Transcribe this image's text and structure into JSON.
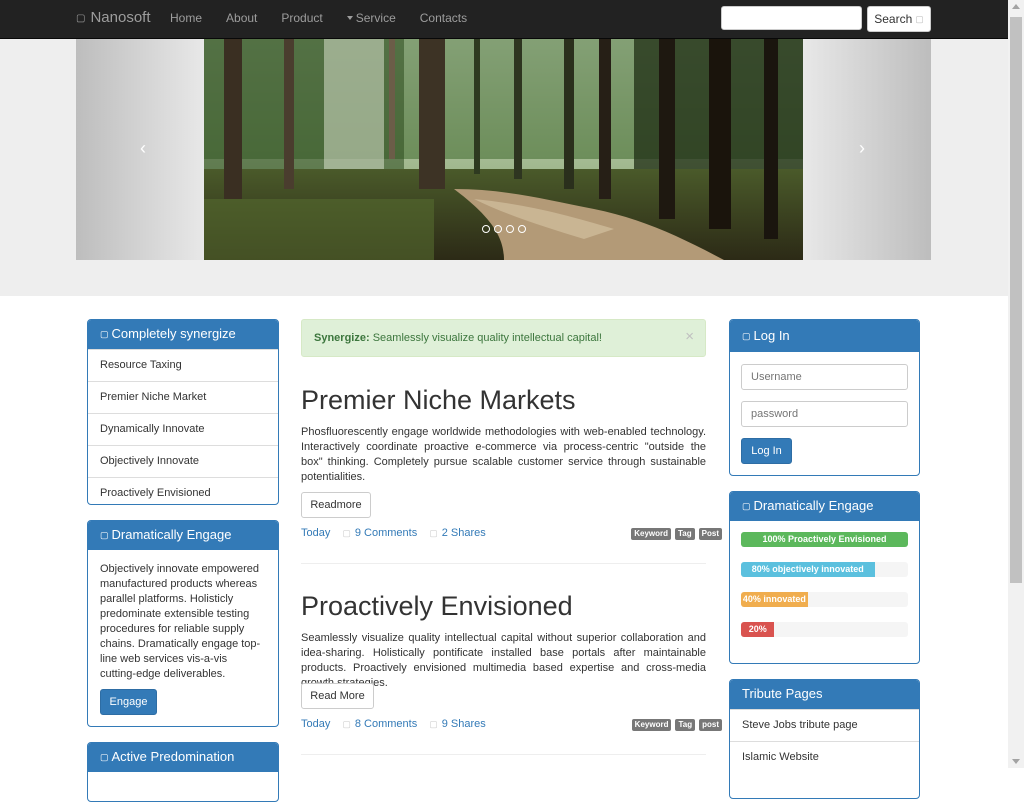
{
  "navbar": {
    "brand": "Nanosoft",
    "links": [
      "Home",
      "About",
      "Product",
      "Service",
      "Contacts"
    ],
    "search_placeholder": "",
    "search_button": "Search"
  },
  "carousel": {
    "prev": "‹",
    "next": "›",
    "indicator_count": 4,
    "active_index": 0
  },
  "left_sidebar": {
    "panel1": {
      "title": "Completely synergize",
      "items": [
        "Resource Taxing",
        "Premier Niche Market",
        "Dynamically Innovate",
        "Objectively Innovate",
        "Proactively Envisioned"
      ]
    },
    "panel2": {
      "title": "Dramatically Engage",
      "body": "Objectively innovate empowered manufactured products whereas parallel platforms. Holisticly predominate extensible testing procedures for reliable supply chains. Dramatically engage top-line web services vis-a-vis cutting-edge deliverables.",
      "button": "Engage"
    },
    "panel3": {
      "title": "Active Predomination"
    }
  },
  "alert": {
    "strong": "Synergize:",
    "text": "Seamlessly visualize quality intellectual capital!",
    "close": "×"
  },
  "posts": [
    {
      "title": "Premier Niche Markets",
      "body": "Phosfluorescently engage worldwide methodologies with web-enabled technology. Interactively coordinate proactive e-commerce via process-centric \"outside the box\" thinking. Completely pursue scalable customer service through sustainable potentialities.",
      "button": "Readmore",
      "date": "Today",
      "comments": "9 Comments",
      "shares": "2 Shares",
      "tags": [
        "Keyword",
        "Tag",
        "Post"
      ]
    },
    {
      "title": "Proactively Envisioned",
      "body": "Seamlessly visualize quality intellectual capital without superior collaboration and idea-sharing. Holistically pontificate installed base portals after maintainable products. Proactively envisioned multimedia based expertise and cross-media growth strategies.",
      "button": "Read More",
      "date": "Today",
      "comments": "8 Comments",
      "shares": "9 Shares",
      "tags": [
        "Keyword",
        "Tag",
        "post"
      ]
    }
  ],
  "right_sidebar": {
    "login": {
      "title": "Log In",
      "username_placeholder": "Username",
      "password_placeholder": "password",
      "button": "Log In"
    },
    "progress_panel": {
      "title": "Dramatically Engage",
      "bars": [
        {
          "label": "100% Proactively Envisioned",
          "value": 100,
          "color": "#5cb85c"
        },
        {
          "label": "80% objectively innovated",
          "value": 80,
          "color": "#5bc0de"
        },
        {
          "label": "40% innovated",
          "value": 40,
          "color": "#f0ad4e"
        },
        {
          "label": "20%",
          "value": 20,
          "color": "#d9534f"
        }
      ]
    },
    "tribute": {
      "title": "Tribute Pages",
      "items": [
        "Steve Jobs tribute page",
        "Islamic Website"
      ]
    }
  },
  "colors": {
    "primary": "#337ab7",
    "navbar": "#222222",
    "alert_bg": "#dff0d8"
  }
}
